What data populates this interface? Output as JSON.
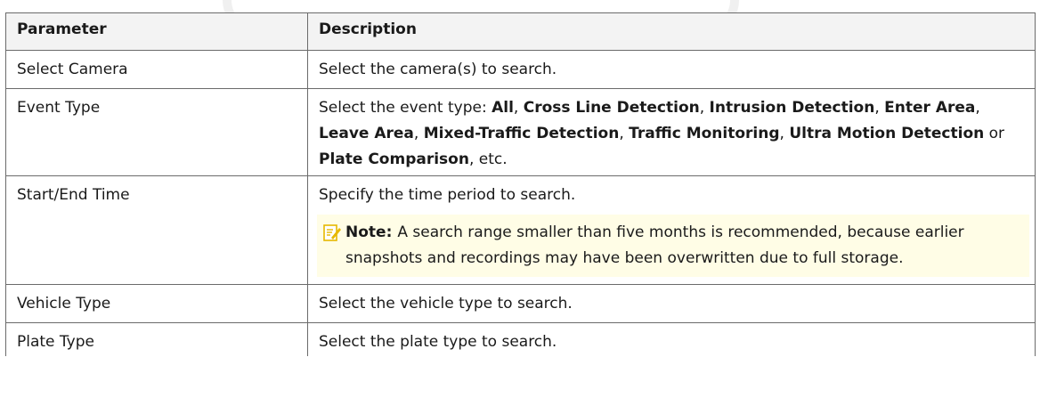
{
  "table": {
    "header": {
      "param": "Parameter",
      "desc": "Description"
    },
    "rows": [
      {
        "param": "Select Camera",
        "desc": "Select the camera(s) to search."
      },
      {
        "param": "Event Type",
        "desc_parts": [
          "Select the event type: ",
          "All",
          ", ",
          "Cross Line Detection",
          ", ",
          "Intrusion Detection",
          ", ",
          "Enter Area",
          ", ",
          "Leave Area",
          ", ",
          "Mixed-Traffic Detection",
          ", ",
          "Traffic Monitoring",
          ", ",
          "Ultra Motion Detection",
          " or ",
          "Plate Comparison",
          ", etc."
        ]
      },
      {
        "param": "Start/End Time",
        "desc": "Specify the time period to search.",
        "note": {
          "label": "Note:",
          "text": "A search range smaller than five months is recommended, because earlier snapshots and recordings may have been overwritten due to full storage.",
          "icon": "note-pencil-icon"
        }
      },
      {
        "param": "Vehicle Type",
        "desc": "Select the vehicle type to search."
      },
      {
        "param": "Plate Type",
        "desc": "Select the plate type to search."
      }
    ]
  },
  "colors": {
    "border": "#6b6b6b",
    "header_bg": "#f3f3f3",
    "note_bg": "#fffde6",
    "note_icon": "#e6b800"
  }
}
